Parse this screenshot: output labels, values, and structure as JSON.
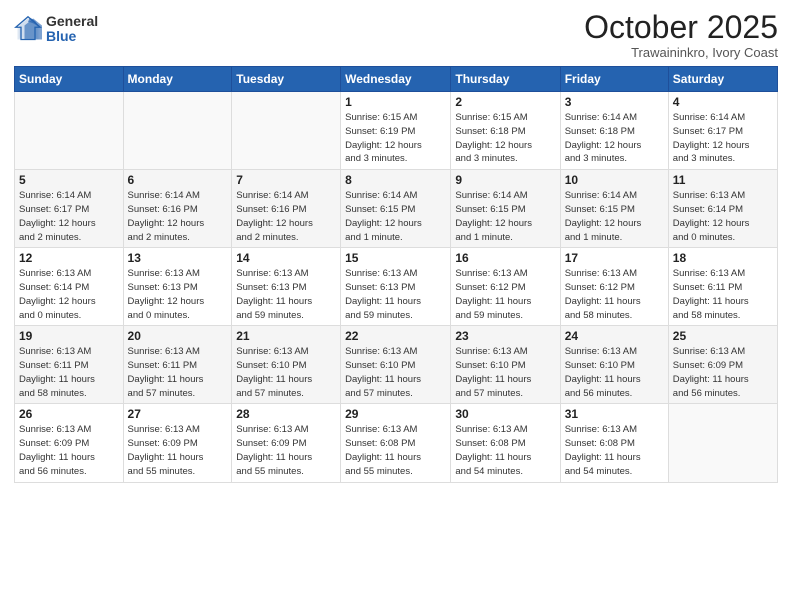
{
  "header": {
    "logo_general": "General",
    "logo_blue": "Blue",
    "month_title": "October 2025",
    "location": "Trawaininkro, Ivory Coast"
  },
  "weekdays": [
    "Sunday",
    "Monday",
    "Tuesday",
    "Wednesday",
    "Thursday",
    "Friday",
    "Saturday"
  ],
  "weeks": [
    [
      {
        "day": "",
        "info": ""
      },
      {
        "day": "",
        "info": ""
      },
      {
        "day": "",
        "info": ""
      },
      {
        "day": "1",
        "info": "Sunrise: 6:15 AM\nSunset: 6:19 PM\nDaylight: 12 hours\nand 3 minutes."
      },
      {
        "day": "2",
        "info": "Sunrise: 6:15 AM\nSunset: 6:18 PM\nDaylight: 12 hours\nand 3 minutes."
      },
      {
        "day": "3",
        "info": "Sunrise: 6:14 AM\nSunset: 6:18 PM\nDaylight: 12 hours\nand 3 minutes."
      },
      {
        "day": "4",
        "info": "Sunrise: 6:14 AM\nSunset: 6:17 PM\nDaylight: 12 hours\nand 3 minutes."
      }
    ],
    [
      {
        "day": "5",
        "info": "Sunrise: 6:14 AM\nSunset: 6:17 PM\nDaylight: 12 hours\nand 2 minutes."
      },
      {
        "day": "6",
        "info": "Sunrise: 6:14 AM\nSunset: 6:16 PM\nDaylight: 12 hours\nand 2 minutes."
      },
      {
        "day": "7",
        "info": "Sunrise: 6:14 AM\nSunset: 6:16 PM\nDaylight: 12 hours\nand 2 minutes."
      },
      {
        "day": "8",
        "info": "Sunrise: 6:14 AM\nSunset: 6:15 PM\nDaylight: 12 hours\nand 1 minute."
      },
      {
        "day": "9",
        "info": "Sunrise: 6:14 AM\nSunset: 6:15 PM\nDaylight: 12 hours\nand 1 minute."
      },
      {
        "day": "10",
        "info": "Sunrise: 6:14 AM\nSunset: 6:15 PM\nDaylight: 12 hours\nand 1 minute."
      },
      {
        "day": "11",
        "info": "Sunrise: 6:13 AM\nSunset: 6:14 PM\nDaylight: 12 hours\nand 0 minutes."
      }
    ],
    [
      {
        "day": "12",
        "info": "Sunrise: 6:13 AM\nSunset: 6:14 PM\nDaylight: 12 hours\nand 0 minutes."
      },
      {
        "day": "13",
        "info": "Sunrise: 6:13 AM\nSunset: 6:13 PM\nDaylight: 12 hours\nand 0 minutes."
      },
      {
        "day": "14",
        "info": "Sunrise: 6:13 AM\nSunset: 6:13 PM\nDaylight: 11 hours\nand 59 minutes."
      },
      {
        "day": "15",
        "info": "Sunrise: 6:13 AM\nSunset: 6:13 PM\nDaylight: 11 hours\nand 59 minutes."
      },
      {
        "day": "16",
        "info": "Sunrise: 6:13 AM\nSunset: 6:12 PM\nDaylight: 11 hours\nand 59 minutes."
      },
      {
        "day": "17",
        "info": "Sunrise: 6:13 AM\nSunset: 6:12 PM\nDaylight: 11 hours\nand 58 minutes."
      },
      {
        "day": "18",
        "info": "Sunrise: 6:13 AM\nSunset: 6:11 PM\nDaylight: 11 hours\nand 58 minutes."
      }
    ],
    [
      {
        "day": "19",
        "info": "Sunrise: 6:13 AM\nSunset: 6:11 PM\nDaylight: 11 hours\nand 58 minutes."
      },
      {
        "day": "20",
        "info": "Sunrise: 6:13 AM\nSunset: 6:11 PM\nDaylight: 11 hours\nand 57 minutes."
      },
      {
        "day": "21",
        "info": "Sunrise: 6:13 AM\nSunset: 6:10 PM\nDaylight: 11 hours\nand 57 minutes."
      },
      {
        "day": "22",
        "info": "Sunrise: 6:13 AM\nSunset: 6:10 PM\nDaylight: 11 hours\nand 57 minutes."
      },
      {
        "day": "23",
        "info": "Sunrise: 6:13 AM\nSunset: 6:10 PM\nDaylight: 11 hours\nand 57 minutes."
      },
      {
        "day": "24",
        "info": "Sunrise: 6:13 AM\nSunset: 6:10 PM\nDaylight: 11 hours\nand 56 minutes."
      },
      {
        "day": "25",
        "info": "Sunrise: 6:13 AM\nSunset: 6:09 PM\nDaylight: 11 hours\nand 56 minutes."
      }
    ],
    [
      {
        "day": "26",
        "info": "Sunrise: 6:13 AM\nSunset: 6:09 PM\nDaylight: 11 hours\nand 56 minutes."
      },
      {
        "day": "27",
        "info": "Sunrise: 6:13 AM\nSunset: 6:09 PM\nDaylight: 11 hours\nand 55 minutes."
      },
      {
        "day": "28",
        "info": "Sunrise: 6:13 AM\nSunset: 6:09 PM\nDaylight: 11 hours\nand 55 minutes."
      },
      {
        "day": "29",
        "info": "Sunrise: 6:13 AM\nSunset: 6:08 PM\nDaylight: 11 hours\nand 55 minutes."
      },
      {
        "day": "30",
        "info": "Sunrise: 6:13 AM\nSunset: 6:08 PM\nDaylight: 11 hours\nand 54 minutes."
      },
      {
        "day": "31",
        "info": "Sunrise: 6:13 AM\nSunset: 6:08 PM\nDaylight: 11 hours\nand 54 minutes."
      },
      {
        "day": "",
        "info": ""
      }
    ]
  ]
}
